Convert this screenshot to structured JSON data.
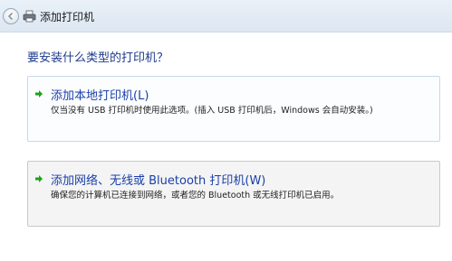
{
  "window": {
    "title": "添加打印机"
  },
  "icons": {
    "back": "back-arrow-icon",
    "printer": "printer-icon",
    "option_arrow": "green-arrow-icon"
  },
  "main": {
    "heading": "要安装什么类型的打印机？",
    "options": [
      {
        "title": "添加本地打印机(L)",
        "description": "仅当没有 USB 打印机时使用此选项。(插入 USB 打印机后，Windows 会自动安装。)"
      },
      {
        "title": "添加网络、无线或 Bluetooth 打印机(W)",
        "description": "确保您的计算机已连接到网络，或者您的 Bluetooth 或无线打印机已启用。"
      }
    ]
  },
  "colors": {
    "accent": "#1a3fa8",
    "arrow_green": "#1aa31a",
    "heading": "#1e3a8a"
  }
}
